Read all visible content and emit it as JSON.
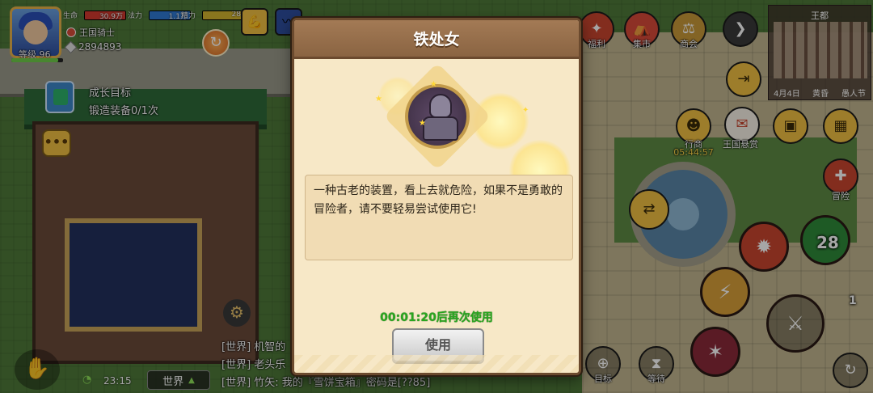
{
  "player": {
    "level_label": "等级 96",
    "level_progress": 0.9,
    "stats": [
      {
        "label": "生命",
        "value": "30.9万",
        "color": "#d43a2f"
      },
      {
        "label": "法力",
        "value": "1.1万",
        "color": "#2f7ad4"
      },
      {
        "label": "精力",
        "value": "28",
        "color": "#d4b62f"
      }
    ],
    "title": "王国骑士",
    "currency": "2894893"
  },
  "quest": {
    "title": "成长目标",
    "subtitle": "锻造装备0/1次"
  },
  "top_icons": [
    {
      "name": "muscle-icon",
      "glyph": "💪",
      "color": "#f1c043"
    },
    {
      "name": "wave-icon",
      "glyph": "〰",
      "color": "#2f4fa0"
    }
  ],
  "menu": {
    "welfare": "福利",
    "market": "集市",
    "guild": "商会",
    "merchant": "行商",
    "merchant_timer": "05:44:57",
    "bounty": "王国悬赏",
    "adventure": "冒险",
    "target": "目标",
    "hourglass": "等待"
  },
  "minimap": {
    "title": "王都",
    "date": "4月4日",
    "time": "黄昏",
    "place": "愚人节"
  },
  "skills": {
    "cooldown_number": "28",
    "side_count": "1"
  },
  "chat": {
    "tab_label": "世界",
    "clock": "23:15",
    "lines": [
      "[世界] 机智的",
      "[世界] 老头乐",
      "[世界] 竹矢: 我的『雪饼宝箱』密码是[??85]"
    ]
  },
  "modal": {
    "title": "铁处女",
    "description": "一种古老的装置，看上去就危险，如果不是勇敢的冒险者，请不要轻易尝试使用它!",
    "cooldown_text": "00:01:20后再次使用",
    "use_button": "使用"
  }
}
